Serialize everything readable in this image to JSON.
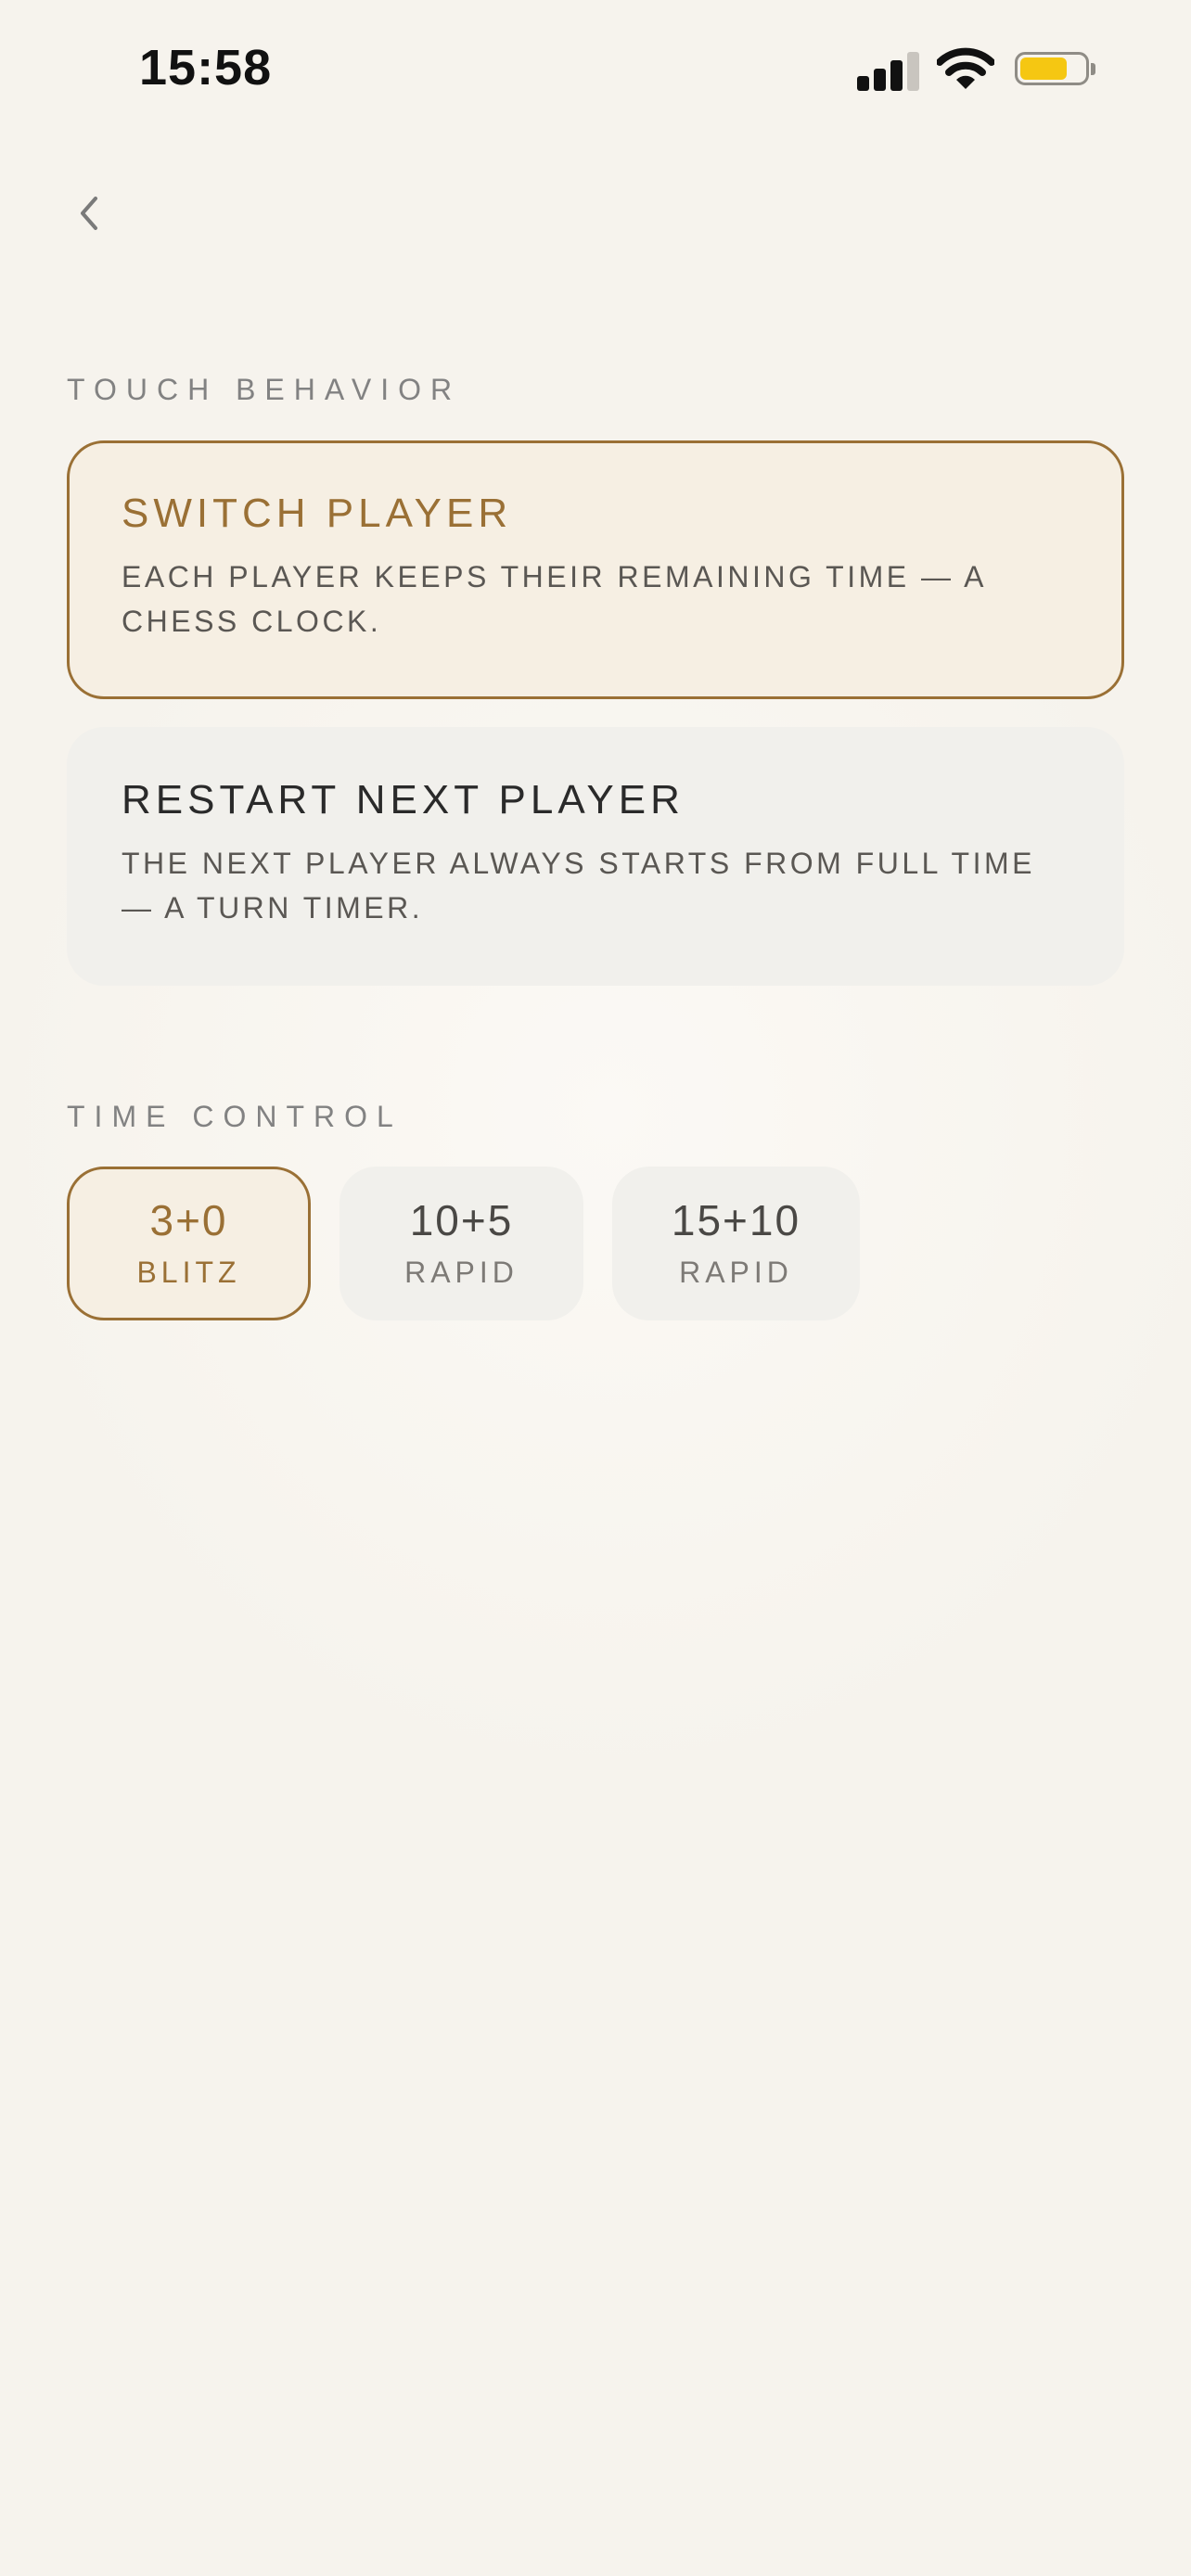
{
  "status_bar": {
    "time": "15:58",
    "icons": [
      "cellular-signal-icon",
      "wifi-icon",
      "battery-icon"
    ],
    "battery_color": "#f5c712"
  },
  "navigation": {
    "back_icon": "chevron-left-icon"
  },
  "touch_behavior": {
    "heading": "TOUCH BEHAVIOR",
    "options": [
      {
        "title": "SWITCH PLAYER",
        "description": "EACH PLAYER KEEPS THEIR REMAINING TIME — A CHESS CLOCK.",
        "selected": true
      },
      {
        "title": "RESTART NEXT PLAYER",
        "description": "THE NEXT PLAYER ALWAYS STARTS FROM FULL TIME — A TURN TIMER.",
        "selected": false
      }
    ]
  },
  "time_control": {
    "heading": "TIME CONTROL",
    "options": [
      {
        "value": "3+0",
        "label": "BLITZ",
        "selected": true
      },
      {
        "value": "10+5",
        "label": "RAPID",
        "selected": false
      },
      {
        "value": "15+10",
        "label": "RAPID",
        "selected": false
      }
    ]
  },
  "colors": {
    "accent": "#9a7035",
    "selected_background": "#f6efe3",
    "unselected_background": "#f1f0ec",
    "page_background": "#f8f5ef"
  }
}
